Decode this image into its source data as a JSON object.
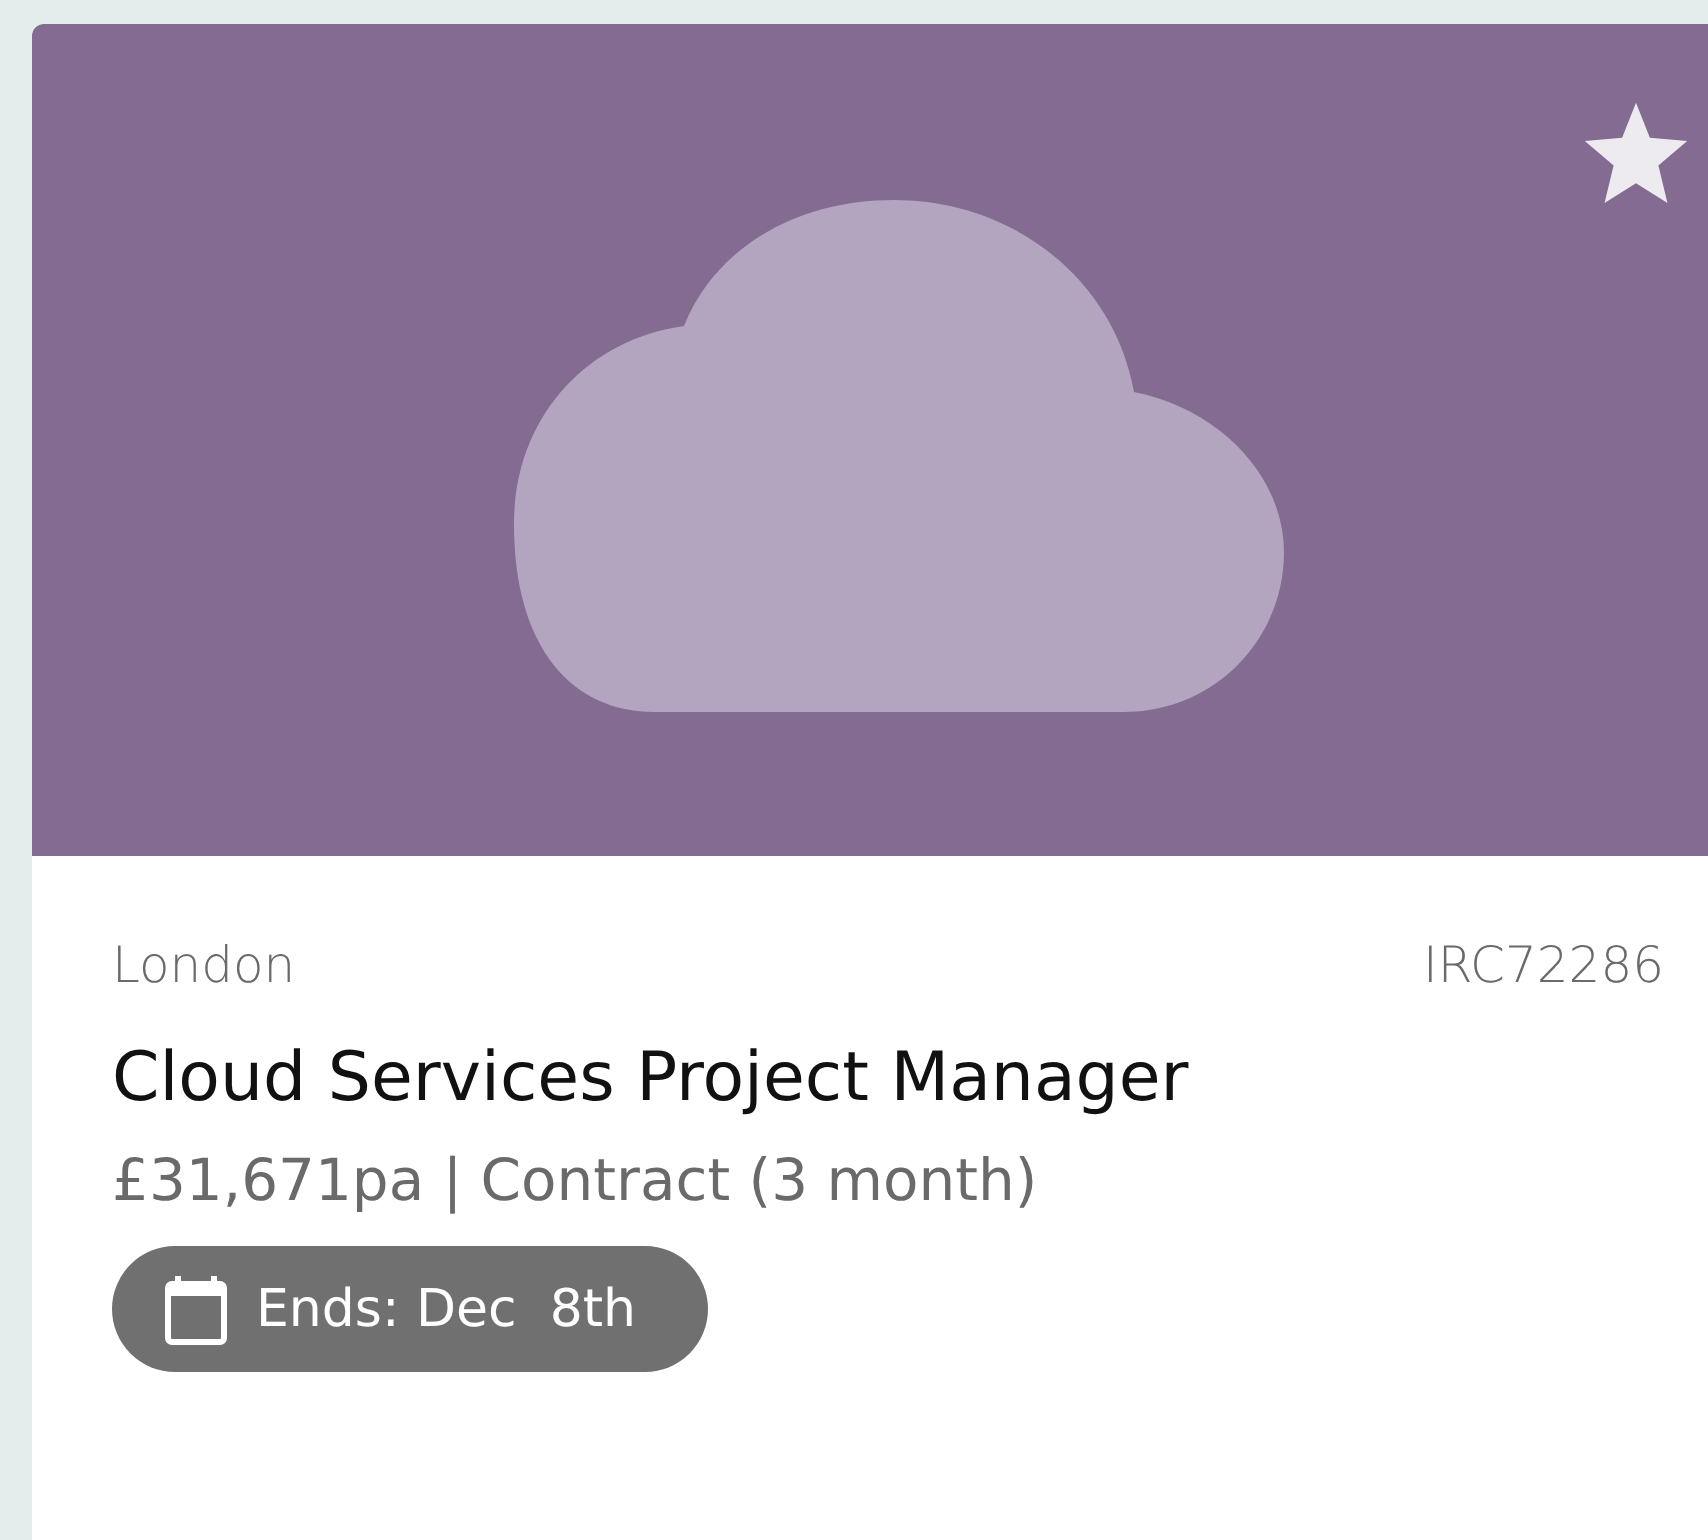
{
  "card": {
    "location": "London",
    "reference": "IRC72286",
    "title": "Cloud Services Project Manager",
    "details": "£31,671pa | Contract (3 month)",
    "end_badge": "Ends: Dec  8th"
  }
}
